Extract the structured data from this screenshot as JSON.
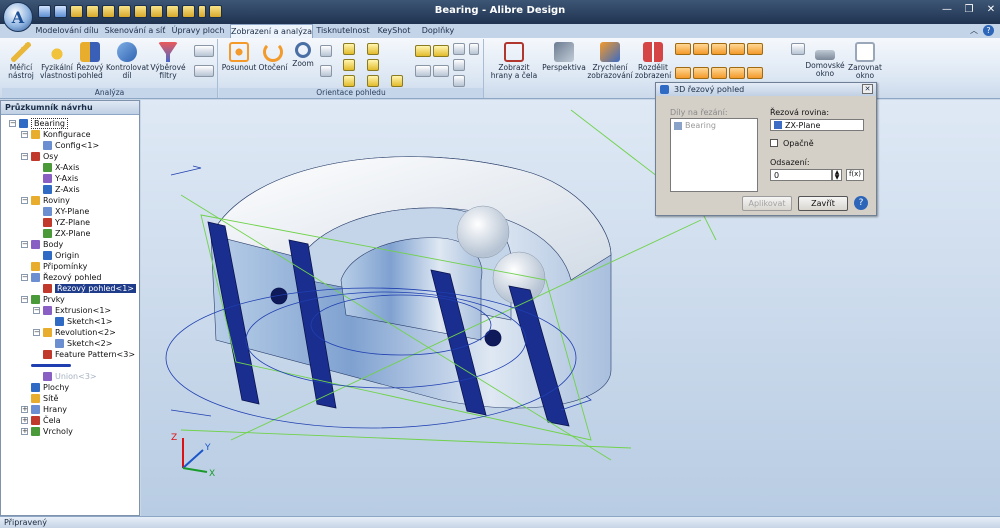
{
  "app": {
    "title": "Bearing - Alibre Design",
    "orb_letter": "A"
  },
  "tabs": [
    {
      "label": "Modelování dílu"
    },
    {
      "label": "Skenování a síť"
    },
    {
      "label": "Úpravy ploch"
    },
    {
      "label": "Zobrazení a analýza",
      "active": true
    },
    {
      "label": "Tisknutelnost"
    },
    {
      "label": "KeyShot"
    },
    {
      "label": "Doplňky"
    }
  ],
  "ribbon": {
    "analysis_group_label": "Analýza",
    "orientation_group_label": "Orientace pohledu",
    "buttons": {
      "measure": "Měřicí nástroj",
      "physical": "Fyzikální vlastnosti",
      "section": "Řezový pohled",
      "check": "Kontrolovat díl",
      "select_filters": "Výběrové filtry",
      "pan": "Posunout",
      "rotate": "Otočení",
      "zoom": "Zoom",
      "show_edges": "Zobrazit hrany a čela",
      "perspective": "Perspektiva",
      "speed": "Zrychlení zobrazování",
      "split": "Rozdělit zobrazení",
      "home": "Domovské okno",
      "align": "Zarovnat okno"
    }
  },
  "panel": {
    "title": "Průzkumník návrhu",
    "tree": [
      {
        "label": "Bearing",
        "level": 0,
        "exp": "−",
        "icon": "bearing-part-icon",
        "boxed": true
      },
      {
        "label": "Konfigurace",
        "level": 1,
        "exp": "−",
        "icon": "configuration-icon"
      },
      {
        "label": "Config<1>",
        "level": 2,
        "icon": "config-icon"
      },
      {
        "label": "Osy",
        "level": 1,
        "exp": "−",
        "icon": "axes-icon"
      },
      {
        "label": "X-Axis",
        "level": 2,
        "icon": "axis-icon"
      },
      {
        "label": "Y-Axis",
        "level": 2,
        "icon": "axis-icon"
      },
      {
        "label": "Z-Axis",
        "level": 2,
        "icon": "axis-icon"
      },
      {
        "label": "Roviny",
        "level": 1,
        "exp": "−",
        "icon": "planes-icon"
      },
      {
        "label": "XY-Plane",
        "level": 2,
        "icon": "plane-icon"
      },
      {
        "label": "YZ-Plane",
        "level": 2,
        "icon": "plane-icon"
      },
      {
        "label": "ZX-Plane",
        "level": 2,
        "icon": "plane-icon"
      },
      {
        "label": "Body",
        "level": 1,
        "exp": "−",
        "icon": "points-icon"
      },
      {
        "label": "Origin",
        "level": 2,
        "icon": "origin-icon"
      },
      {
        "label": "Připomínky",
        "level": 1,
        "icon": "annotations-icon"
      },
      {
        "label": "Řezový pohled",
        "level": 1,
        "exp": "−",
        "icon": "section-view-icon"
      },
      {
        "label": "Řezový pohled<1>",
        "level": 2,
        "icon": "section-icon",
        "selected": true
      },
      {
        "label": "Prvky",
        "level": 1,
        "exp": "−",
        "icon": "features-icon"
      },
      {
        "label": "Extrusion<1>",
        "level": 2,
        "exp": "−",
        "icon": "extrusion-icon"
      },
      {
        "label": "Sketch<1>",
        "level": 3,
        "icon": "sketch-icon"
      },
      {
        "label": "Revolution<2>",
        "level": 2,
        "exp": "−",
        "icon": "revolution-icon"
      },
      {
        "label": "Sketch<2>",
        "level": 3,
        "icon": "sketch-icon"
      },
      {
        "label": "Feature Pattern<3>",
        "level": 2,
        "icon": "pattern-icon"
      },
      {
        "label": "",
        "level": 1,
        "icon": "rollback-marker-icon",
        "marker": true
      },
      {
        "label": "Union<3>",
        "level": 2,
        "icon": "union-icon",
        "dim": true
      },
      {
        "label": "Plochy",
        "level": 1,
        "icon": "surfaces-icon"
      },
      {
        "label": "Sítě",
        "level": 1,
        "icon": "meshes-icon"
      },
      {
        "label": "Hrany",
        "level": 1,
        "exp": "+",
        "icon": "edges-icon"
      },
      {
        "label": "Čela",
        "level": 1,
        "exp": "+",
        "icon": "faces-icon"
      },
      {
        "label": "Vrcholy",
        "level": 1,
        "exp": "+",
        "icon": "vertices-icon"
      }
    ]
  },
  "dialog": {
    "title": "3D řezový pohled",
    "parts_label": "Díly na řezání:",
    "parts": [
      "Bearing"
    ],
    "plane_label": "Řezová rovina:",
    "plane_value": "ZX-Plane",
    "opposite_label": "Opačně",
    "offset_label": "Odsazení:",
    "offset_value": "0",
    "fx_label": "f(x)",
    "apply_label": "Aplikovat",
    "close_label": "Zavřít"
  },
  "triad": {
    "x": "X",
    "y": "Y",
    "z": "Z"
  },
  "status": {
    "text": "Připravený"
  },
  "colors": {
    "accent": "#1f3c8a",
    "section_fill": "#1a2e8f",
    "wire": "#6fd24a"
  }
}
